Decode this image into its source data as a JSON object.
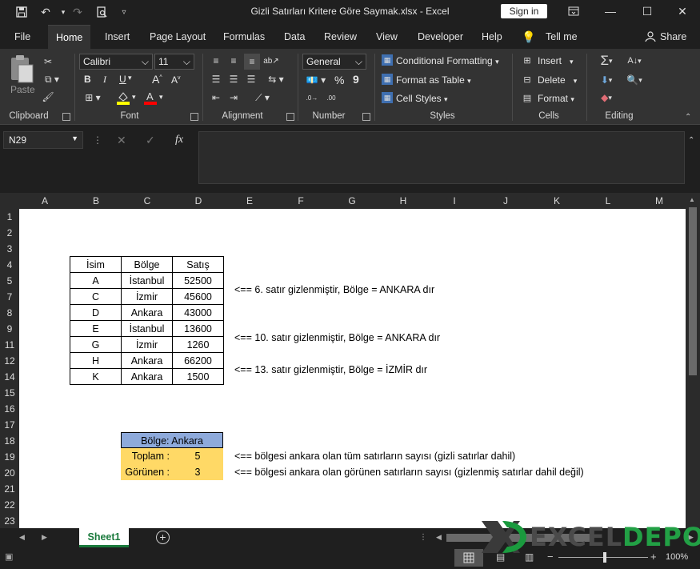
{
  "window": {
    "title": "Gizli Satırları Kritere Göre Saymak.xlsx  -  Excel",
    "signin": "Sign in"
  },
  "menu": {
    "tabs": [
      "File",
      "Home",
      "Insert",
      "Page Layout",
      "Formulas",
      "Data",
      "Review",
      "View",
      "Developer",
      "Help"
    ],
    "tellme": "Tell me",
    "share": "Share"
  },
  "ribbon": {
    "clipboard": {
      "paste": "Paste",
      "label": "Clipboard"
    },
    "font": {
      "name": "Calibri",
      "size": "11",
      "label": "Font",
      "bold": "B",
      "italic": "I",
      "underline": "U"
    },
    "alignment": {
      "label": "Alignment"
    },
    "number": {
      "format": "General",
      "percent": "%",
      "comma": "9",
      "label": "Number"
    },
    "styles": {
      "conditional": "Conditional Formatting",
      "table": "Format as Table",
      "cell": "Cell Styles",
      "label": "Styles"
    },
    "cells": {
      "insert": "Insert",
      "delete": "Delete",
      "format": "Format",
      "label": "Cells"
    },
    "editing": {
      "label": "Editing"
    }
  },
  "formula_bar": {
    "namebox": "N29",
    "fx": "fx"
  },
  "grid": {
    "columns": [
      "A",
      "B",
      "C",
      "D",
      "E",
      "F",
      "G",
      "H",
      "I",
      "J",
      "K",
      "L",
      "M"
    ],
    "rows": [
      "1",
      "2",
      "3",
      "4",
      "5",
      "7",
      "8",
      "9",
      "11",
      "12",
      "14",
      "15",
      "16",
      "17",
      "18",
      "19",
      "20",
      "21",
      "22",
      "23"
    ]
  },
  "table": {
    "headers": [
      "İsim",
      "Bölge",
      "Satış"
    ],
    "rows": [
      [
        "A",
        "İstanbul",
        "52500"
      ],
      [
        "C",
        "İzmir",
        "45600"
      ],
      [
        "D",
        "Ankara",
        "43000"
      ],
      [
        "E",
        "İstanbul",
        "13600"
      ],
      [
        "G",
        "İzmir",
        "1260"
      ],
      [
        "H",
        "Ankara",
        "66200"
      ],
      [
        "K",
        "Ankara",
        "1500"
      ]
    ]
  },
  "notes": {
    "row5": "<== 6. satır gizlenmiştir, Bölge = ANKARA dır",
    "row11": "<== 10. satır gizlenmiştir, Bölge = ANKARA dır",
    "row14": "<== 13. satır gizlenmiştir, Bölge = İZMİR dır",
    "row19": "<== bölgesi ankara olan tüm satırların sayısı (gizli satırlar dahil)",
    "row20": "<== bölgesi ankara olan görünen satırların sayısı (gizlenmiş satırlar dahil değil)"
  },
  "summary": {
    "header": "Bölge:  Ankara",
    "total_label": "Toplam :",
    "total_value": "5",
    "visible_label": "Görünen :",
    "visible_value": "3"
  },
  "sheet_tabs": {
    "active": "Sheet1"
  },
  "status": {
    "zoom": "100%"
  },
  "watermark": {
    "left": "EXCEL",
    "right": "DEPO"
  },
  "colors": {
    "accent": "#1a7a3c",
    "summary_header": "#8eaadb",
    "summary_body": "#ffd966"
  }
}
